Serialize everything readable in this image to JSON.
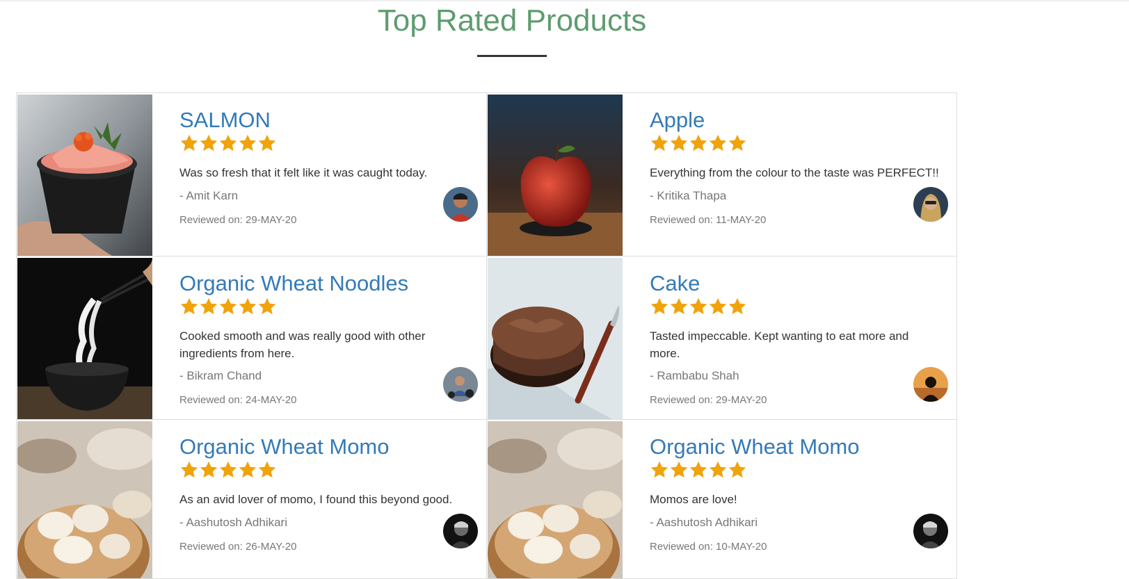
{
  "section": {
    "title": "Top Rated Products"
  },
  "colors": {
    "title": "#5e9c6e",
    "product_name": "#337ab7",
    "star": "#f0a30a",
    "border": "#dcdcdc"
  },
  "products": [
    {
      "name": "SALMON",
      "rating": 5,
      "review": "Was so fresh that it felt like it was caught today.",
      "author": "- Amit Karn",
      "date": "Reviewed on: 29-MAY-20",
      "image": "salmon-bowl-photo",
      "avatar": "reviewer-avatar"
    },
    {
      "name": "Apple",
      "rating": 5,
      "review": "Everything from the colour to the taste was PERFECT!!",
      "author": "- Kritika Thapa",
      "date": "Reviewed on: 11-MAY-20",
      "image": "apple-photo",
      "avatar": "reviewer-avatar"
    },
    {
      "name": "Organic Wheat Noodles",
      "rating": 5,
      "review": "Cooked smooth and was really good with other ingredients from here.",
      "author": "- Bikram Chand",
      "date": "Reviewed on: 24-MAY-20",
      "image": "noodles-photo",
      "avatar": "reviewer-avatar"
    },
    {
      "name": "Cake",
      "rating": 5,
      "review": "Tasted impeccable. Kept wanting to eat more and more.",
      "author": "- Rambabu Shah",
      "date": "Reviewed on: 29-MAY-20",
      "image": "chocolate-cake-photo",
      "avatar": "reviewer-avatar"
    },
    {
      "name": "Organic Wheat Momo",
      "rating": 5,
      "review": "As an avid lover of momo, I found this beyond good.",
      "author": "- Aashutosh Adhikari",
      "date": "Reviewed on: 26-MAY-20",
      "image": "momo-photo",
      "avatar": "reviewer-avatar"
    },
    {
      "name": "Organic Wheat Momo",
      "rating": 5,
      "review": "Momos are love!",
      "author": "- Aashutosh Adhikari",
      "date": "Reviewed on: 10-MAY-20",
      "image": "momo-photo",
      "avatar": "reviewer-avatar"
    }
  ]
}
